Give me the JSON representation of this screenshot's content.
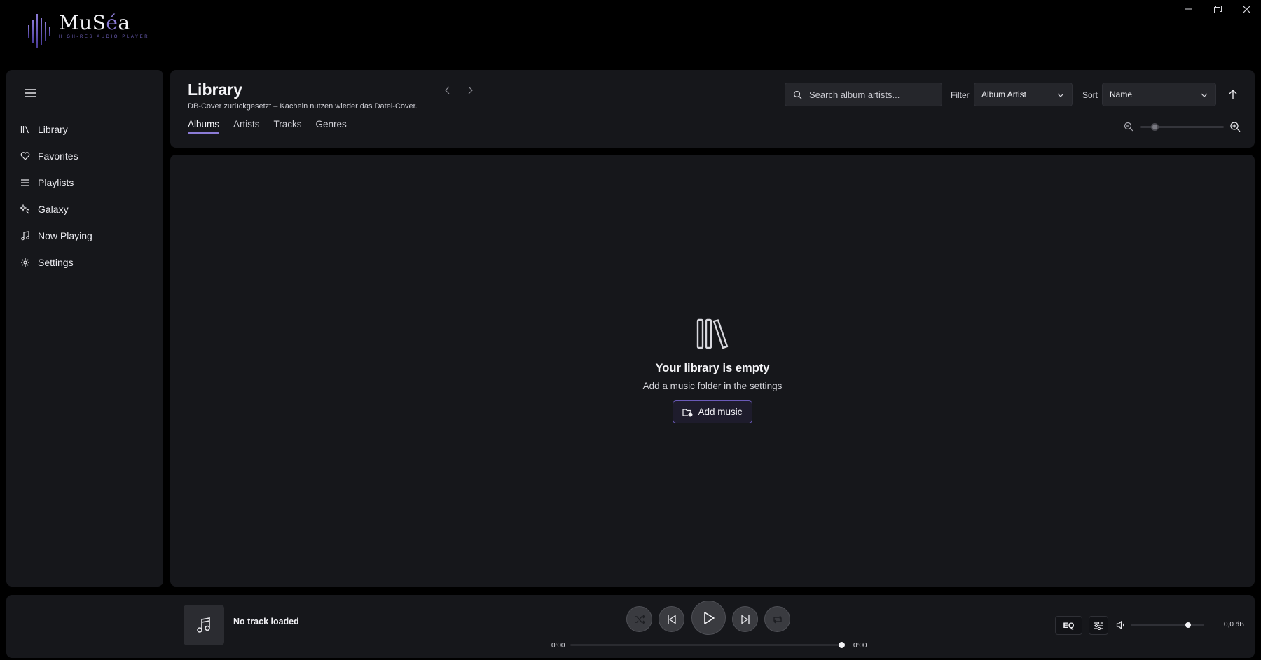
{
  "app": {
    "name_prefix": "MuS",
    "name_accent": "é",
    "name_suffix": "a",
    "tagline": "HIGH-RES AUDIO PLAYER",
    "accent_color": "#8b7bd6"
  },
  "window_controls": [
    "minimize-icon",
    "restore-icon",
    "close-icon"
  ],
  "sidebar": {
    "items": [
      {
        "label": "Library",
        "icon": "library-icon"
      },
      {
        "label": "Favorites",
        "icon": "heart-icon"
      },
      {
        "label": "Playlists",
        "icon": "list-icon"
      },
      {
        "label": "Galaxy",
        "icon": "sparkle-icon"
      },
      {
        "label": "Now Playing",
        "icon": "music-note-icon"
      },
      {
        "label": "Settings",
        "icon": "gear-icon"
      }
    ]
  },
  "header": {
    "title": "Library",
    "subtitle": "DB-Cover zurückgesetzt – Kacheln nutzen wieder das Datei-Cover.",
    "tabs": [
      {
        "label": "Albums",
        "active": true
      },
      {
        "label": "Artists",
        "active": false
      },
      {
        "label": "Tracks",
        "active": false
      },
      {
        "label": "Genres",
        "active": false
      }
    ],
    "search": {
      "placeholder": "Search album artists..."
    },
    "filter": {
      "label": "Filter",
      "value": "Album Artist"
    },
    "sort": {
      "label": "Sort",
      "value": "Name"
    },
    "zoom_level": 0.15
  },
  "empty_state": {
    "title": "Your library is empty",
    "description": "Add a music folder in the settings",
    "button_label": "Add music"
  },
  "player": {
    "track_title": "No track loaded",
    "time_elapsed": "0:00",
    "time_total": "0:00",
    "progress": 1.0,
    "eq_label": "EQ",
    "volume": 0.8,
    "gain": "0,0 dB"
  }
}
